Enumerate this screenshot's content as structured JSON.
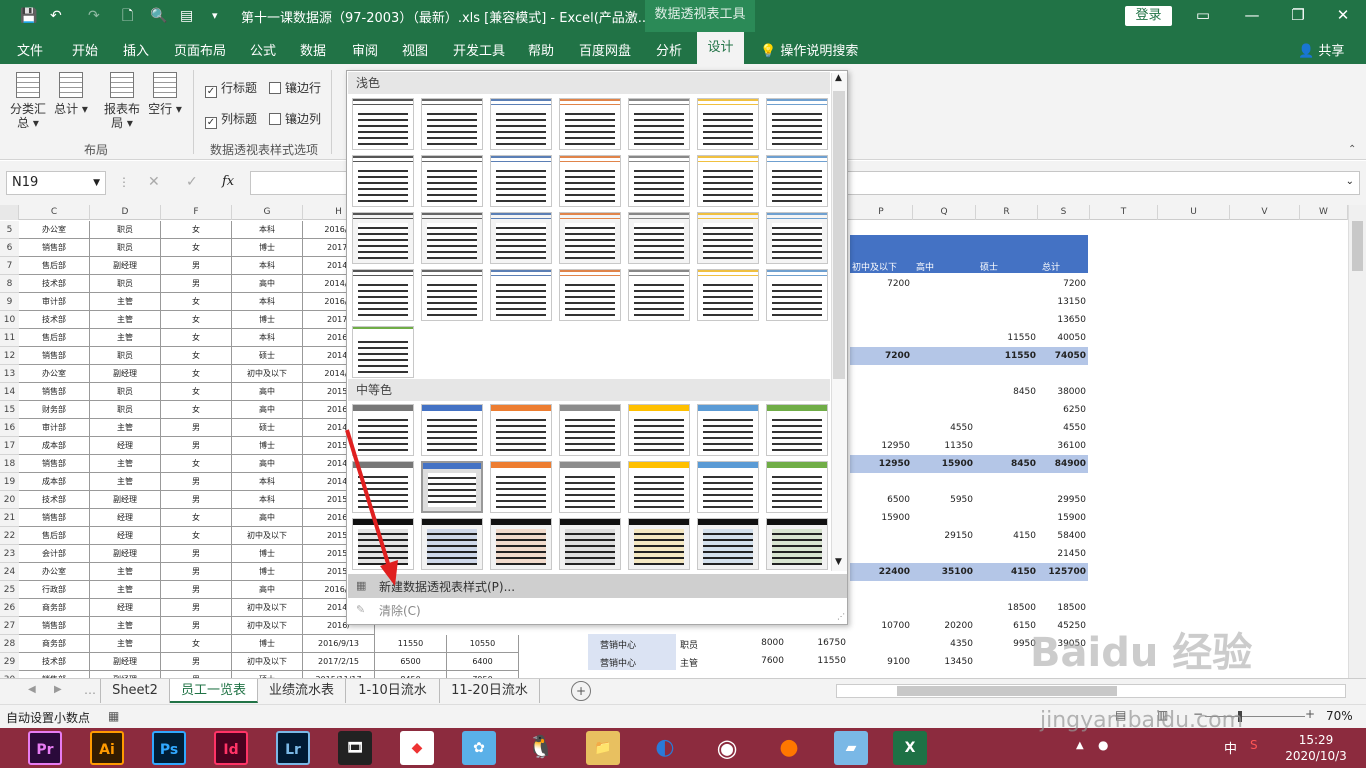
{
  "titlebar": {
    "title": "第十一课数据源（97-2003）（最新）.xls  [兼容模式]  -  Excel(产品激...",
    "context": "数据透视表工具",
    "login": "登录",
    "save_icon": "save-icon"
  },
  "tabs": [
    "文件",
    "开始",
    "插入",
    "页面布局",
    "公式",
    "数据",
    "审阅",
    "视图",
    "开发工具",
    "帮助",
    "百度网盘",
    "分析"
  ],
  "active_tab": "设计",
  "tell_me": "操作说明搜索",
  "share": "共享",
  "ribbon": {
    "buttons": [
      {
        "label": "分类汇总 ▾"
      },
      {
        "label": "总计 ▾"
      },
      {
        "label": "报表布局 ▾"
      },
      {
        "label": "空行 ▾"
      }
    ],
    "layout_group": "布局",
    "options_group": "数据透视表样式选项",
    "checks": [
      {
        "label": "行标题",
        "checked": true
      },
      {
        "label": "镶边行",
        "checked": false
      },
      {
        "label": "列标题",
        "checked": true
      },
      {
        "label": "镶边列",
        "checked": false
      }
    ]
  },
  "formula": {
    "namebox": "N19",
    "fx": "fx"
  },
  "columns_left": [
    "C",
    "D",
    "F",
    "G",
    "H"
  ],
  "columns_right": [
    "P",
    "Q",
    "R",
    "S",
    "T",
    "U",
    "V",
    "W"
  ],
  "rows": [
    {
      "n": "5",
      "c": "办公室",
      "d": "职员",
      "f": "女",
      "g": "本科",
      "h": "2016/1"
    },
    {
      "n": "6",
      "c": "销售部",
      "d": "职员",
      "f": "女",
      "g": "博士",
      "h": "2017/"
    },
    {
      "n": "7",
      "c": "售后部",
      "d": "副经理",
      "f": "男",
      "g": "本科",
      "h": "2014/"
    },
    {
      "n": "8",
      "c": "技术部",
      "d": "职员",
      "f": "男",
      "g": "高中",
      "h": "2014/3"
    },
    {
      "n": "9",
      "c": "审计部",
      "d": "主管",
      "f": "女",
      "g": "本科",
      "h": "2016/1"
    },
    {
      "n": "10",
      "c": "技术部",
      "d": "主管",
      "f": "女",
      "g": "博士",
      "h": "2017/"
    },
    {
      "n": "11",
      "c": "售后部",
      "d": "主管",
      "f": "女",
      "g": "本科",
      "h": "2016/"
    },
    {
      "n": "12",
      "c": "销售部",
      "d": "职员",
      "f": "女",
      "g": "硕士",
      "h": "2014/"
    },
    {
      "n": "13",
      "c": "办公室",
      "d": "副经理",
      "f": "女",
      "g": "初中及以下",
      "h": "2014/1"
    },
    {
      "n": "14",
      "c": "销售部",
      "d": "职员",
      "f": "女",
      "g": "高中",
      "h": "2015/"
    },
    {
      "n": "15",
      "c": "财务部",
      "d": "职员",
      "f": "女",
      "g": "高中",
      "h": "2016/"
    },
    {
      "n": "16",
      "c": "审计部",
      "d": "主管",
      "f": "男",
      "g": "硕士",
      "h": "2014/"
    },
    {
      "n": "17",
      "c": "成本部",
      "d": "经理",
      "f": "男",
      "g": "博士",
      "h": "2015/"
    },
    {
      "n": "18",
      "c": "销售部",
      "d": "主管",
      "f": "女",
      "g": "高中",
      "h": "2014/"
    },
    {
      "n": "19",
      "c": "成本部",
      "d": "主管",
      "f": "男",
      "g": "本科",
      "h": "2014/"
    },
    {
      "n": "20",
      "c": "技术部",
      "d": "副经理",
      "f": "男",
      "g": "本科",
      "h": "2015/"
    },
    {
      "n": "21",
      "c": "销售部",
      "d": "经理",
      "f": "女",
      "g": "高中",
      "h": "2016/"
    },
    {
      "n": "22",
      "c": "售后部",
      "d": "经理",
      "f": "女",
      "g": "初中及以下",
      "h": "2015/"
    },
    {
      "n": "23",
      "c": "会计部",
      "d": "副经理",
      "f": "男",
      "g": "博士",
      "h": "2015/"
    },
    {
      "n": "24",
      "c": "办公室",
      "d": "主管",
      "f": "男",
      "g": "博士",
      "h": "2015/"
    },
    {
      "n": "25",
      "c": "行政部",
      "d": "主管",
      "f": "男",
      "g": "高中",
      "h": "2016/1"
    },
    {
      "n": "26",
      "c": "商务部",
      "d": "经理",
      "f": "男",
      "g": "初中及以下",
      "h": "2014/"
    },
    {
      "n": "27",
      "c": "销售部",
      "d": "主管",
      "f": "男",
      "g": "初中及以下",
      "h": "2016/"
    },
    {
      "n": "28",
      "c": "商务部",
      "d": "主管",
      "f": "女",
      "g": "博士",
      "h": "2016/9/13",
      "i": "11550",
      "j": "10550"
    },
    {
      "n": "29",
      "c": "技术部",
      "d": "副经理",
      "f": "男",
      "g": "初中及以下",
      "h": "2017/2/15",
      "i": "6500",
      "j": "6400"
    },
    {
      "n": "30",
      "c": "销售部",
      "d": "副经理",
      "f": "男",
      "g": "硕士",
      "h": "2015/11/17",
      "i": "8450",
      "j": "7950"
    }
  ],
  "pivot": {
    "headers": [
      "初中及以下",
      "高中",
      "硕士",
      "总计"
    ],
    "cells": [
      {
        "row": "8",
        "p": "7200",
        "q": "",
        "r": "",
        "s": "7200"
      },
      {
        "row": "9",
        "p": "",
        "q": "",
        "r": "",
        "s": "13150"
      },
      {
        "row": "10",
        "p": "",
        "q": "",
        "r": "",
        "s": "13650"
      },
      {
        "row": "11",
        "p": "",
        "q": "",
        "r": "11550",
        "s": "40050"
      },
      {
        "row": "12",
        "p": "7200",
        "q": "",
        "r": "11550",
        "s": "74050",
        "band": true
      },
      {
        "row": "14",
        "p": "",
        "q": "",
        "r": "8450",
        "s": "38000"
      },
      {
        "row": "15",
        "p": "",
        "q": "",
        "r": "",
        "s": "6250"
      },
      {
        "row": "16",
        "p": "",
        "q": "4550",
        "r": "",
        "s": "4550"
      },
      {
        "row": "17",
        "p": "12950",
        "q": "11350",
        "r": "",
        "s": "36100"
      },
      {
        "row": "18",
        "p": "12950",
        "q": "15900",
        "r": "8450",
        "s": "84900",
        "band": true
      },
      {
        "row": "20",
        "p": "6500",
        "q": "5950",
        "r": "",
        "s": "29950"
      },
      {
        "row": "21",
        "p": "15900",
        "q": "",
        "r": "",
        "s": "15900"
      },
      {
        "row": "22",
        "p": "",
        "q": "29150",
        "r": "4150",
        "s": "58400"
      },
      {
        "row": "23",
        "p": "",
        "q": "",
        "r": "",
        "s": "21450"
      },
      {
        "row": "24",
        "p": "22400",
        "q": "35100",
        "r": "4150",
        "s": "125700",
        "band": true
      },
      {
        "row": "26",
        "p": "",
        "q": "",
        "r": "18500",
        "s": "18500"
      },
      {
        "row": "27",
        "p": "10700",
        "q": "20200",
        "r": "6150",
        "s": "45250"
      },
      {
        "row": "28",
        "p": "",
        "q": "4350",
        "r": "9950",
        "s": "39050"
      },
      {
        "row": "29",
        "p": "9100",
        "q": "13450",
        "r": "",
        "s": ""
      }
    ],
    "lower_rows": [
      {
        "label": "营销中心",
        "role": "职员",
        "a": "8000",
        "b": "16750"
      },
      {
        "label": "营销中心",
        "role": "主管",
        "a": "7600",
        "b": "11550"
      }
    ]
  },
  "gallery": {
    "light_label": "浅色",
    "medium_label": "中等色",
    "new_style": "新建数据透视表样式(P)...",
    "clear": "清除(C)",
    "light_colors": [
      "#555555",
      "#666666",
      "#5b7fb5",
      "#e0844a",
      "#888888",
      "#f0c040",
      "#6fa0d0"
    ],
    "medium_colors": [
      "#777777",
      "#4472c4",
      "#ed7d31",
      "#8c8c8c",
      "#ffc000",
      "#5b9bd5",
      "#70ad47"
    ]
  },
  "sheet_tabs": [
    "Sheet2",
    "员工一览表",
    "业绩流水表",
    "1-10日流水",
    "11-20日流水"
  ],
  "active_sheet": "员工一览表",
  "status": {
    "left": "自动设置小数点",
    "zoom": "70%"
  },
  "taskbar": {
    "apps": [
      "Pr",
      "Ai",
      "Ps",
      "Id",
      "Lr"
    ],
    "time": "15:29",
    "date": "2020/10/3",
    "ime": "中"
  },
  "watermark": {
    "line1": "Baidu 经验",
    "line2": "jingyan.baidu.com"
  }
}
